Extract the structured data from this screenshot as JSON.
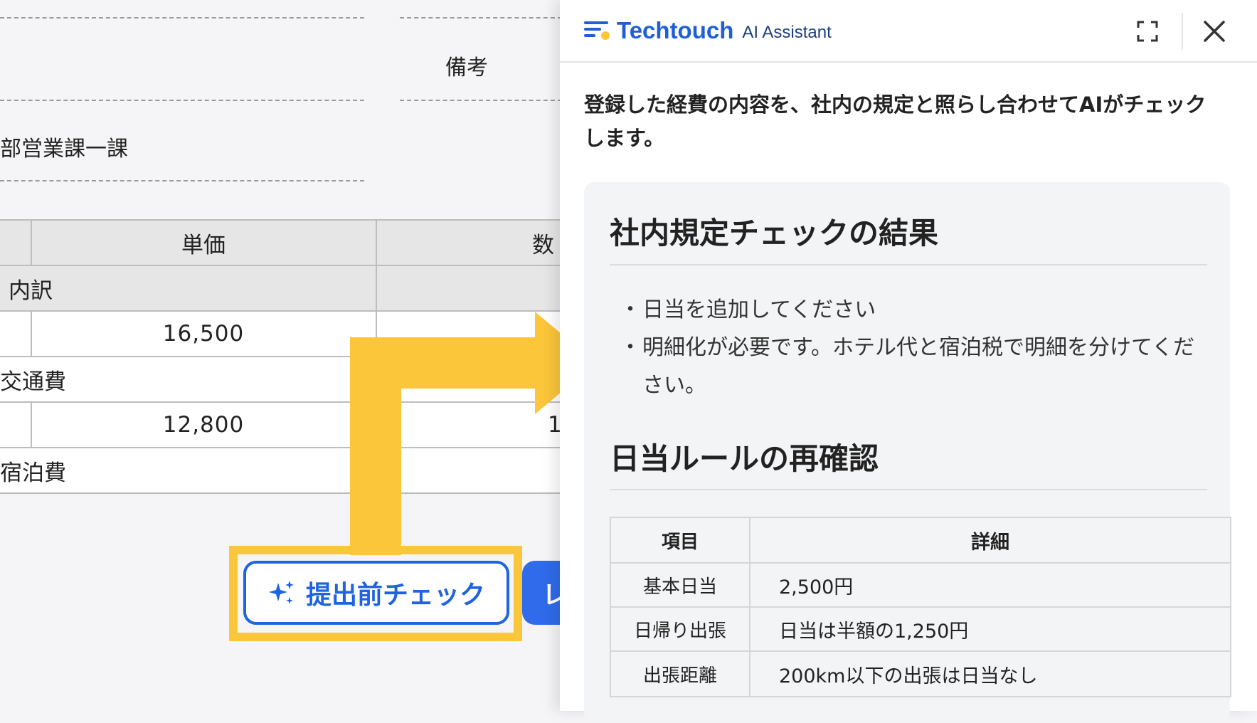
{
  "form": {
    "remarks_label": "備考",
    "department_value": "部営業課一課",
    "table": {
      "header_unit_price": "単価",
      "header_quantity_partial": "数",
      "breakdown_label": "内訳",
      "rows": [
        {
          "unit_price": "16,500",
          "quantity": ""
        },
        {
          "category": "交通費"
        },
        {
          "unit_price": "12,800",
          "quantity": "1"
        },
        {
          "category": "宿泊費"
        }
      ]
    },
    "submit_check_label": "提出前チェック",
    "next_button_partial": "レ"
  },
  "assistant": {
    "brand_name": "Techtouch",
    "brand_sub": "AI Assistant",
    "intro": "登録した経費の内容を、社内の規定と照らし合わせてAIがチェックします。",
    "section1_title": "社内規定チェックの結果",
    "bullets": [
      "日当を追加してください",
      "明細化が必要です。ホテル代と宿泊税で明細を分けてください。"
    ],
    "section2_title": "日当ルールの再確認",
    "rules_table": {
      "headers": [
        "項目",
        "詳細"
      ],
      "rows": [
        [
          "基本日当",
          "2,500円"
        ],
        [
          "日帰り出張",
          "日当は半額の1,250円"
        ],
        [
          "出張距離",
          "200km以下の出張は日当なし"
        ]
      ]
    }
  },
  "colors": {
    "brand_blue": "#1f5fd6",
    "button_blue": "#1f63e0",
    "highlight_yellow": "#fbc63a"
  }
}
